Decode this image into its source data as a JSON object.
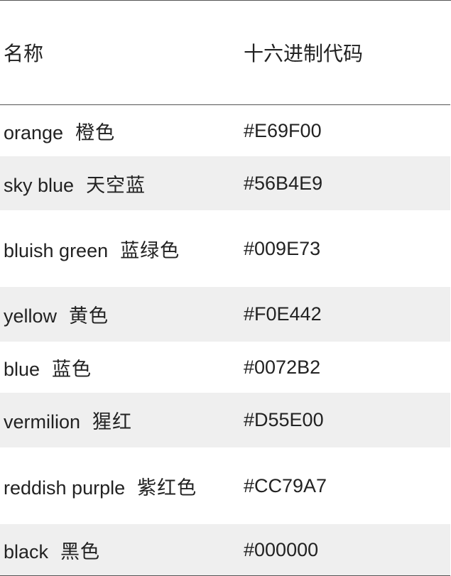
{
  "header": {
    "name_label": "名称",
    "hex_label": "十六进制代码"
  },
  "rows": [
    {
      "en": "orange",
      "zh": "橙色",
      "hex": "#E69F00"
    },
    {
      "en": "sky blue",
      "zh": "天空蓝",
      "hex": "#56B4E9"
    },
    {
      "en": "bluish green",
      "zh": "蓝绿色",
      "hex": "#009E73"
    },
    {
      "en": "yellow",
      "zh": "黄色",
      "hex": "#F0E442"
    },
    {
      "en": "blue",
      "zh": "蓝色",
      "hex": "#0072B2"
    },
    {
      "en": "vermilion",
      "zh": "猩红",
      "hex": "#D55E00"
    },
    {
      "en": "reddish purple",
      "zh": "紫红色",
      "hex": "#CC79A7"
    },
    {
      "en": "black",
      "zh": "黑色",
      "hex": "#000000"
    }
  ],
  "colors": {
    "row_shade": "#efefef",
    "rule": "#555555",
    "text": "#222222"
  }
}
